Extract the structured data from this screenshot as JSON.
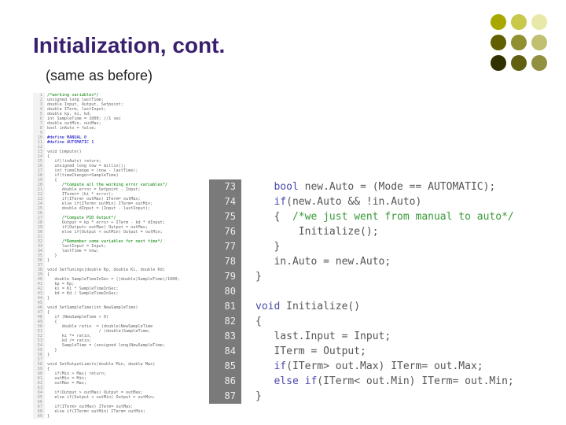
{
  "title": "Initialization, cont.",
  "subtitle": "(same as before)",
  "dots": [
    "#a8a800",
    "#c8c84a",
    "#e8e8a8",
    "#606000",
    "#909030",
    "#c0c070",
    "#303000",
    "#606010",
    "#909040"
  ],
  "left_lines": [
    {
      "n": "1",
      "t": "/*working variables*/",
      "c": "cmt"
    },
    {
      "n": "2",
      "t": "unsigned long lastTime;",
      "c": ""
    },
    {
      "n": "3",
      "t": "double Input, Output, Setpoint;",
      "c": ""
    },
    {
      "n": "4",
      "t": "double ITerm, lastInput;",
      "c": ""
    },
    {
      "n": "5",
      "t": "double kp, ki, kd;",
      "c": ""
    },
    {
      "n": "6",
      "t": "int SampleTime = 1000; //1 sec",
      "c": ""
    },
    {
      "n": "7",
      "t": "double outMin, outMax;",
      "c": ""
    },
    {
      "n": "8",
      "t": "bool inAuto = false;",
      "c": ""
    },
    {
      "n": "9",
      "t": "",
      "c": ""
    },
    {
      "n": "10",
      "t": "#define MANUAL 0",
      "c": "kw"
    },
    {
      "n": "11",
      "t": "#define AUTOMATIC 1",
      "c": "kw"
    },
    {
      "n": "12",
      "t": "",
      "c": ""
    },
    {
      "n": "13",
      "t": "void Compute()",
      "c": ""
    },
    {
      "n": "14",
      "t": "{",
      "c": ""
    },
    {
      "n": "15",
      "t": "   if(!inAuto) return;",
      "c": ""
    },
    {
      "n": "16",
      "t": "   unsigned long now = millis();",
      "c": ""
    },
    {
      "n": "17",
      "t": "   int timeChange = (now - lastTime);",
      "c": ""
    },
    {
      "n": "18",
      "t": "   if(timeChange>=SampleTime)",
      "c": ""
    },
    {
      "n": "19",
      "t": "   {",
      "c": ""
    },
    {
      "n": "20",
      "t": "      /*Compute all the working error variables*/",
      "c": "cmt"
    },
    {
      "n": "21",
      "t": "      double error = Setpoint - Input;",
      "c": ""
    },
    {
      "n": "22",
      "t": "      ITerm+= (ki * error);",
      "c": ""
    },
    {
      "n": "23",
      "t": "      if(ITerm> outMax) ITerm= outMax;",
      "c": ""
    },
    {
      "n": "24",
      "t": "      else if(ITerm< outMin) ITerm= outMin;",
      "c": ""
    },
    {
      "n": "25",
      "t": "      double dInput = (Input - lastInput);",
      "c": ""
    },
    {
      "n": "26",
      "t": "",
      "c": ""
    },
    {
      "n": "27",
      "t": "      /*Compute PID Output*/",
      "c": "cmt"
    },
    {
      "n": "28",
      "t": "      Output = kp * error + ITerm - kd * dInput;",
      "c": ""
    },
    {
      "n": "29",
      "t": "      if(Output> outMax) Output = outMax;",
      "c": ""
    },
    {
      "n": "30",
      "t": "      else if(Output < outMin) Output = outMin;",
      "c": ""
    },
    {
      "n": "31",
      "t": "",
      "c": ""
    },
    {
      "n": "32",
      "t": "      /*Remember some variables for next time*/",
      "c": "cmt"
    },
    {
      "n": "33",
      "t": "      lastInput = Input;",
      "c": ""
    },
    {
      "n": "34",
      "t": "      lastTime = now;",
      "c": ""
    },
    {
      "n": "35",
      "t": "   }",
      "c": ""
    },
    {
      "n": "36",
      "t": "}",
      "c": ""
    },
    {
      "n": "37",
      "t": "",
      "c": ""
    },
    {
      "n": "38",
      "t": "void SetTunings(double Kp, double Ki, double Kd)",
      "c": ""
    },
    {
      "n": "39",
      "t": "{",
      "c": ""
    },
    {
      "n": "40",
      "t": "   double SampleTimeInSec = ((double)SampleTime)/1000;",
      "c": ""
    },
    {
      "n": "41",
      "t": "   kp = Kp;",
      "c": ""
    },
    {
      "n": "42",
      "t": "   ki = Ki * SampleTimeInSec;",
      "c": ""
    },
    {
      "n": "43",
      "t": "   kd = Kd / SampleTimeInSec;",
      "c": ""
    },
    {
      "n": "44",
      "t": "}",
      "c": ""
    },
    {
      "n": "45",
      "t": "",
      "c": ""
    },
    {
      "n": "46",
      "t": "void SetSampleTime(int NewSampleTime)",
      "c": ""
    },
    {
      "n": "47",
      "t": "{",
      "c": ""
    },
    {
      "n": "48",
      "t": "   if (NewSampleTime > 0)",
      "c": ""
    },
    {
      "n": "49",
      "t": "   {",
      "c": ""
    },
    {
      "n": "50",
      "t": "      double ratio  = (double)NewSampleTime",
      "c": ""
    },
    {
      "n": "51",
      "t": "                     / (double)SampleTime;",
      "c": ""
    },
    {
      "n": "52",
      "t": "      ki *= ratio;",
      "c": ""
    },
    {
      "n": "53",
      "t": "      kd /= ratio;",
      "c": ""
    },
    {
      "n": "54",
      "t": "      SampleTime = (unsigned long)NewSampleTime;",
      "c": ""
    },
    {
      "n": "55",
      "t": "   }",
      "c": ""
    },
    {
      "n": "56",
      "t": "}",
      "c": ""
    },
    {
      "n": "57",
      "t": "",
      "c": ""
    },
    {
      "n": "58",
      "t": "void SetOutputLimits(double Min, double Max)",
      "c": ""
    },
    {
      "n": "59",
      "t": "{",
      "c": ""
    },
    {
      "n": "60",
      "t": "   if(Min > Max) return;",
      "c": ""
    },
    {
      "n": "61",
      "t": "   outMin = Min;",
      "c": ""
    },
    {
      "n": "62",
      "t": "   outMax = Max;",
      "c": ""
    },
    {
      "n": "63",
      "t": "",
      "c": ""
    },
    {
      "n": "64",
      "t": "   if(Output > outMax) Output = outMax;",
      "c": ""
    },
    {
      "n": "65",
      "t": "   else if(Output < outMin) Output = outMin;",
      "c": ""
    },
    {
      "n": "66",
      "t": "",
      "c": ""
    },
    {
      "n": "67",
      "t": "   if(ITerm> outMax) ITerm= outMax;",
      "c": ""
    },
    {
      "n": "68",
      "t": "   else if(ITerm< outMin) ITerm= outMin;",
      "c": ""
    },
    {
      "n": "69",
      "t": "}",
      "c": ""
    }
  ],
  "right_lines": [
    {
      "n": "73",
      "html": "   <span class='type'>bool</span> new.Auto = (Mode == AUTOMATIC);"
    },
    {
      "n": "74",
      "html": "   <span class='kw'>if</span>(new.Auto && !in.Auto)"
    },
    {
      "n": "75",
      "html": "   {  <span class='cmt'>/*we just went from manual to auto*/</span>"
    },
    {
      "n": "76",
      "html": "       Initialize();"
    },
    {
      "n": "77",
      "html": "   }"
    },
    {
      "n": "78",
      "html": "   in.Auto = new.Auto;"
    },
    {
      "n": "79",
      "html": "}"
    },
    {
      "n": "80",
      "html": ""
    },
    {
      "n": "81",
      "html": "<span class='type'>void</span> Initialize()"
    },
    {
      "n": "82",
      "html": "{"
    },
    {
      "n": "83",
      "html": "   last.Input = Input;"
    },
    {
      "n": "84",
      "html": "   ITerm = Output;"
    },
    {
      "n": "85",
      "html": "   <span class='kw'>if</span>(ITerm&gt; out.Max) ITerm= out.Max;"
    },
    {
      "n": "86",
      "html": "   <span class='kw'>else</span> <span class='kw'>if</span>(ITerm&lt; out.Min) ITerm= out.Min;"
    },
    {
      "n": "87",
      "html": "}"
    }
  ]
}
